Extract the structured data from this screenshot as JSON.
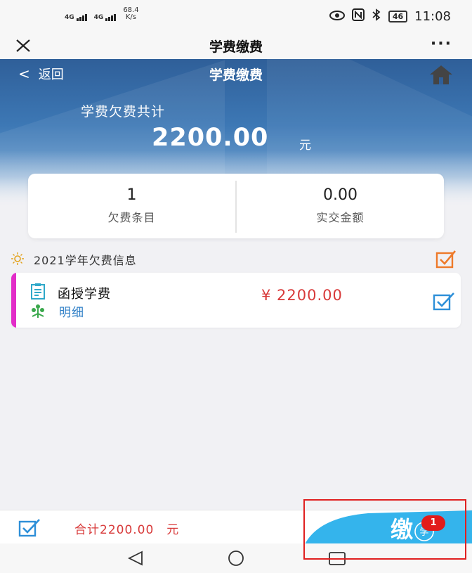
{
  "status_bar": {
    "signal1_label": "4G",
    "signal2_label": "4G",
    "net_speed_value": "68.4",
    "net_speed_unit": "K/s",
    "battery": "46",
    "time": "11:08",
    "icons": [
      "eye-icon",
      "nfc-icon",
      "bluetooth-icon"
    ]
  },
  "title_bar": {
    "title": "学费缴费",
    "more": "···"
  },
  "hero": {
    "back_label": "返回",
    "back_chevron": "<",
    "title": "学费缴费",
    "owed_label": "学费欠费共计",
    "owed_amount": "2200.00",
    "owed_unit": "元"
  },
  "summary": {
    "items_count": "1",
    "items_label": "欠费条目",
    "paid_amount": "0.00",
    "paid_label": "实交金额"
  },
  "section": {
    "title": "2021学年欠费信息"
  },
  "fee_item": {
    "name": "函授学费",
    "detail_label": "明细",
    "amount": "¥ 2200.00"
  },
  "bottom_bar": {
    "total_text": "合计2200.00　元",
    "pay_label": "缴",
    "pay_sub_label": "学",
    "badge_count": "1"
  },
  "colors": {
    "accent_red": "#d83a3a",
    "check_blue": "#2d8fd8",
    "check_orange": "#ee7a2a",
    "item_bar": "#e22dc8",
    "pay_button": "#34b4ec",
    "badge": "#e21b1b"
  }
}
